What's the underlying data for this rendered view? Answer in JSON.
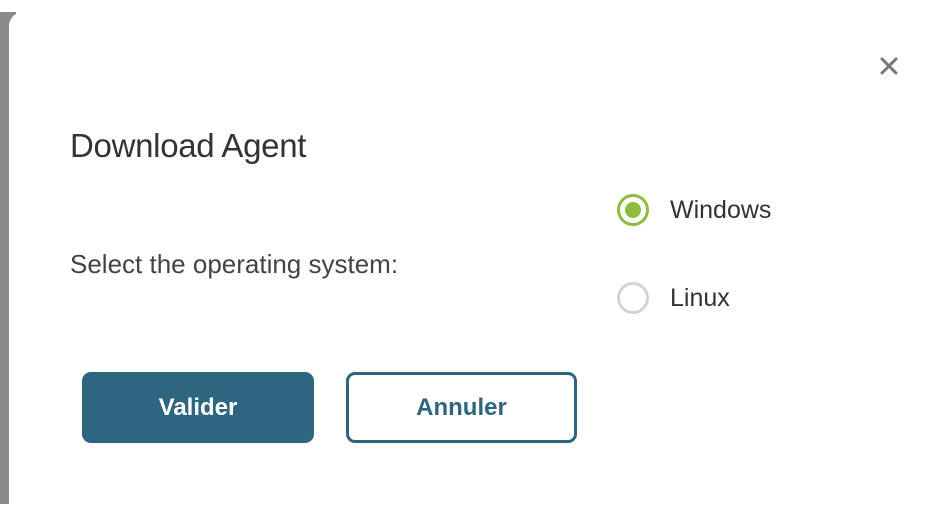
{
  "dialog": {
    "title": "Download Agent",
    "prompt": "Select the operating system:",
    "os_options": [
      {
        "label": "Windows",
        "selected": true
      },
      {
        "label": "Linux",
        "selected": false
      }
    ],
    "buttons": {
      "confirm_label": "Valider",
      "cancel_label": "Annuler"
    },
    "close_icon": "close-icon"
  },
  "colors": {
    "primary": "#2e6580",
    "radio_selected": "#8cbd3e",
    "radio_unselected": "#d4d4d4",
    "backdrop_edge": "#8a8a8a"
  }
}
